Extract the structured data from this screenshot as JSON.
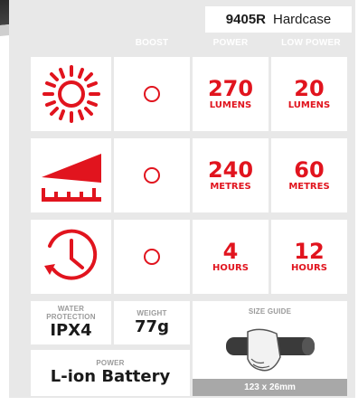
{
  "product": {
    "model_code": "9405R",
    "model_variant": "Hardcase"
  },
  "columns": {
    "boost": "BOOST",
    "power": "POWER",
    "low_power": "LOW POWER"
  },
  "rows": [
    {
      "icon": "sun-icon",
      "power_value": "270",
      "power_unit": "LUMENS",
      "low_value": "20",
      "low_unit": "LUMENS"
    },
    {
      "icon": "beam-distance-icon",
      "power_value": "240",
      "power_unit": "METRES",
      "low_value": "60",
      "low_unit": "METRES"
    },
    {
      "icon": "clock-icon",
      "power_value": "4",
      "power_unit": "HOURS",
      "low_value": "12",
      "low_unit": "HOURS"
    }
  ],
  "specs": {
    "water_label_line1": "WATER",
    "water_label_line2": "PROTECTION",
    "water_value": "IPX4",
    "weight_label": "WEIGHT",
    "weight_value": "77g",
    "power_label": "POWER",
    "power_value": "L-ion Battery",
    "size_label": "SIZE GUIDE",
    "size_value": "123 x 26mm"
  },
  "colors": {
    "accent": "#e1141e",
    "panel": "#e8e8e8",
    "text": "#1a1a1a",
    "muted": "#9a9a9a"
  }
}
